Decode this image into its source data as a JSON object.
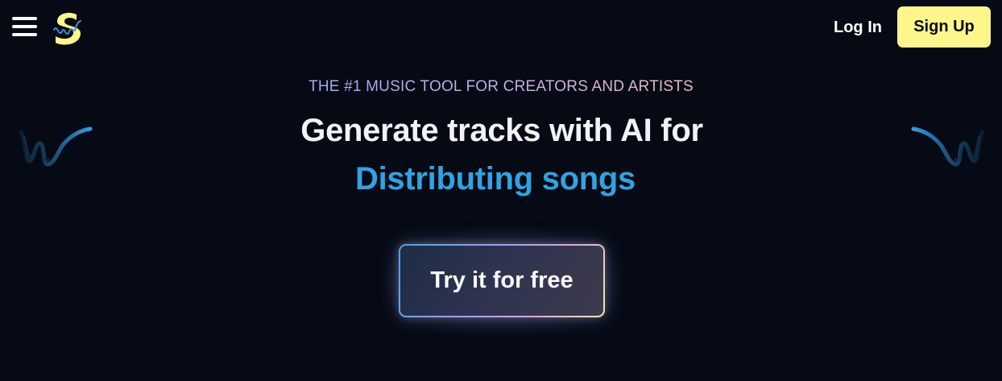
{
  "header": {
    "menu_icon": "hamburger-menu-icon",
    "logo_icon": "s-soundwave-logo-icon",
    "login_label": "Log In",
    "signup_label": "Sign Up"
  },
  "hero": {
    "eyebrow": "THE #1 MUSIC TOOL FOR CREATORS AND ARTISTS",
    "headline": "Generate tracks with AI for",
    "headline_accent": "Distributing songs",
    "cta_label": "Try it for free"
  },
  "colors": {
    "background": "#050a14",
    "signup_bg": "#fdf68b",
    "accent_blue": "#2fa3e3",
    "logo_yellow": "#fdf68b"
  },
  "decorations": {
    "left_wave_icon": "sound-wave-icon",
    "right_wave_icon": "sound-wave-icon"
  }
}
